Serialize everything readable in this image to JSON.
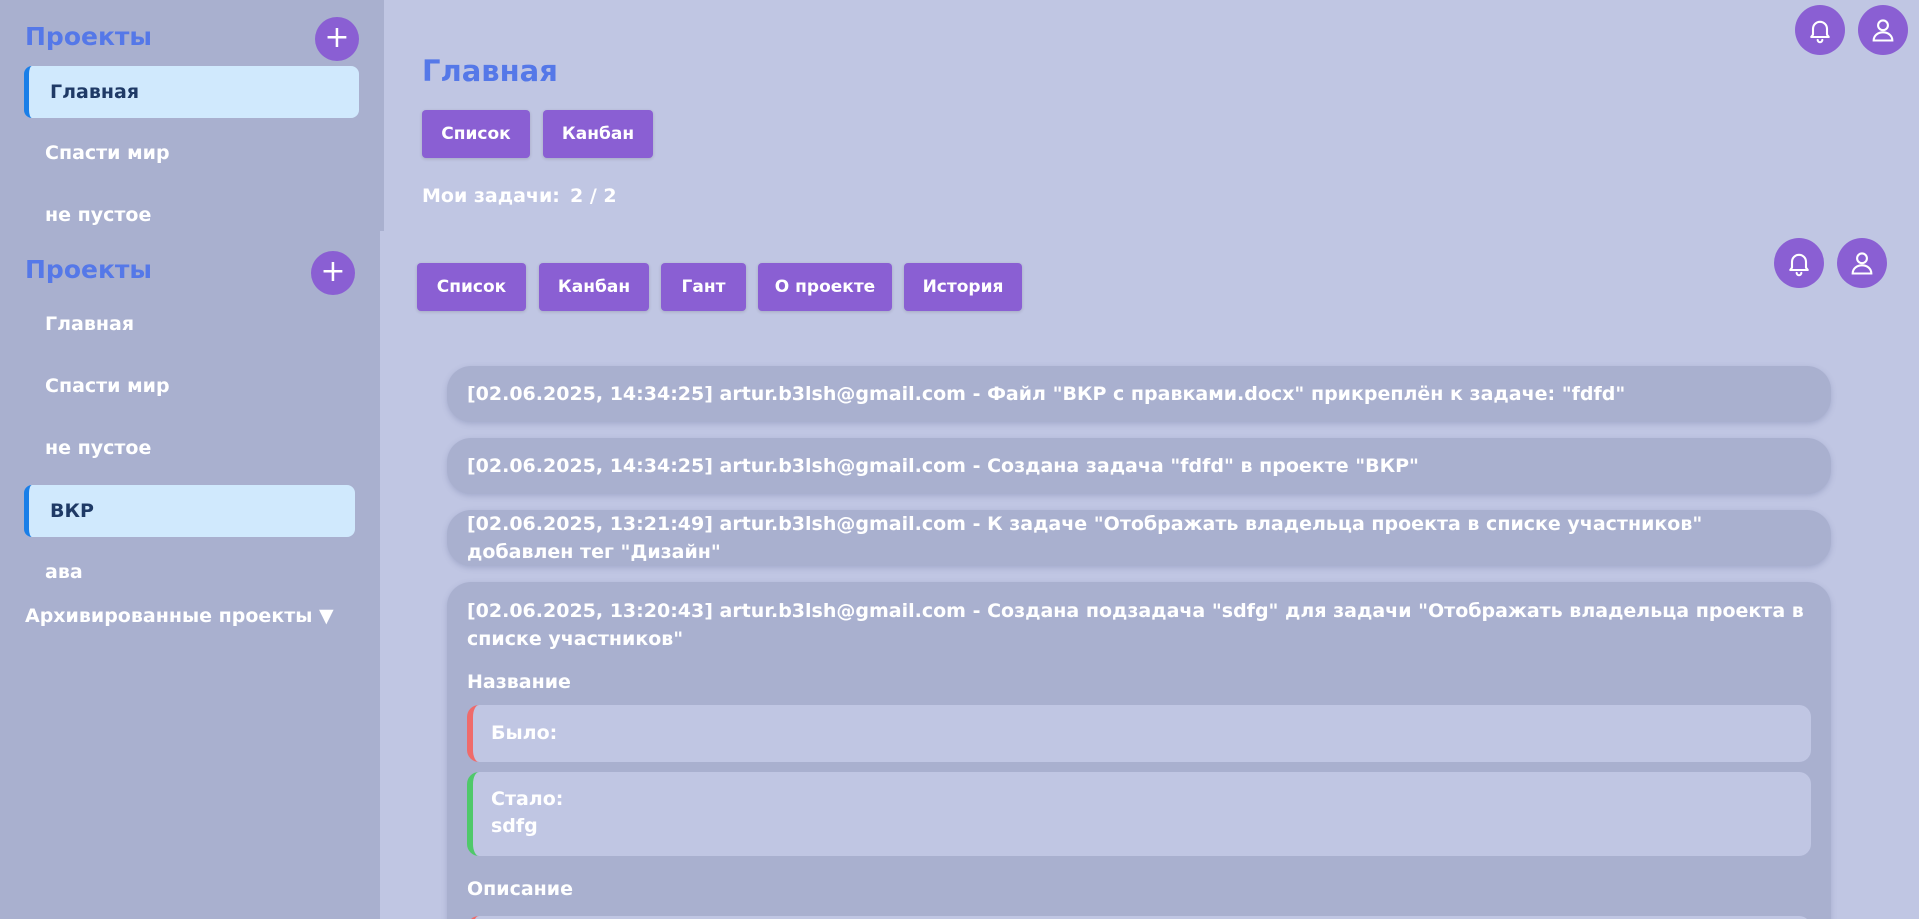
{
  "top_sidebar": {
    "heading": "Проекты",
    "add_label": "+",
    "items": [
      "Главная",
      "Спасти мир",
      "не пустое"
    ]
  },
  "bottom_sidebar": {
    "heading": "Проекты",
    "add_label": "+",
    "items": [
      "Главная",
      "Спасти мир",
      "не пустое",
      "ВКР",
      "ава"
    ],
    "archived": "Архивированные проекты ▼"
  },
  "main": {
    "title": "Главная",
    "view_buttons": [
      "Список",
      "Канбан"
    ],
    "my_tasks_label": "Мои задачи:",
    "my_tasks_value": "2 / 2"
  },
  "project_tabs": [
    "Список",
    "Канбан",
    "Гант",
    "О проекте",
    "История"
  ],
  "history": [
    "[02.06.2025, 14:34:25] artur.b3lsh@gmail.com - Файл \"ВКР с правками.docx\" прикреплён к задаче: \"fdfd\"",
    "[02.06.2025, 14:34:25] artur.b3lsh@gmail.com - Создана задача \"fdfd\" в проекте \"ВКР\"",
    "[02.06.2025, 13:21:49] artur.b3lsh@gmail.com - К задаче \"Отображать владельца проекта в списке участников\" добавлен тег \"Дизайн\"",
    "[02.06.2025, 13:20:43] artur.b3lsh@gmail.com - Создана подзадача \"sdfg\" для задачи \"Отображать владельца проекта в списке участников\""
  ],
  "detail": {
    "name_label": "Название",
    "was_label": "Было:",
    "now_label": "Стало:",
    "now_value": "sdfg",
    "description_label": "Описание"
  },
  "colors": {
    "accent": "#8a5fd3",
    "heading": "#5578e8",
    "background": "#c0c6e3",
    "panel": "#a9b0cf",
    "active_item_bg": "#d0e9fd",
    "active_item_border": "#1a7fe8",
    "diff_was": "#ef6b6b",
    "diff_now": "#4fc96a"
  },
  "icons": [
    "plus-icon",
    "bell-icon",
    "user-icon"
  ]
}
